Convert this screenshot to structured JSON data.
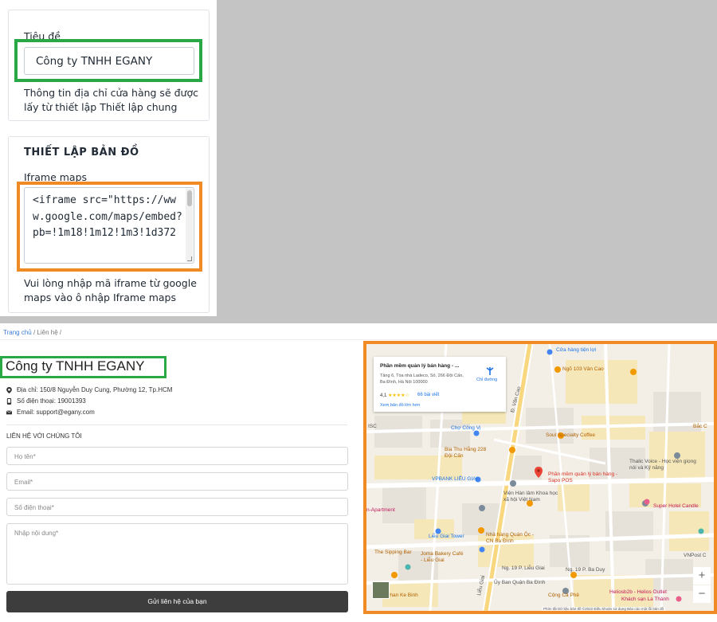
{
  "admin": {
    "title_card": {
      "label": "Tiêu đề",
      "value": "Công ty TNHH EGANY",
      "help": "Thông tin địa chỉ cửa hàng sẽ được lấy từ thiết lập Thiết lập chung"
    },
    "map_card": {
      "heading": "THIẾT LẬP BẢN ĐỒ",
      "label": "Iframe maps",
      "value": "<iframe src=\"https://www.google.com/maps/embed?pb=!1m18!1m12!1m3!1d372",
      "help": "Vui lòng nhập mã iframe từ google maps vào ô nhập Iframe maps"
    },
    "colors": {
      "highlight_green": "#2aa845",
      "highlight_orange": "#f08a24"
    }
  },
  "storefront": {
    "breadcrumb": {
      "home": "Trang chủ",
      "sep1": " / ",
      "current": "Liên hệ",
      "sep2": " /"
    },
    "company_name": "Công ty TNHH EGANY",
    "info": {
      "address": "Địa chỉ: 150/8 Nguyễn Duy Cung, Phường 12, Tp.HCM",
      "phone": "Số điện thoại: 19001393",
      "email": "Email: support@egany.com"
    },
    "contact_heading": "LIÊN HỆ VỚI CHÚNG TÔI",
    "form": {
      "name_placeholder": "Họ tên*",
      "email_placeholder": "Email*",
      "phone_placeholder": "Số điện thoại*",
      "message_placeholder": "Nhập nội dung*",
      "submit_label": "Gửi liên hệ của bạn"
    }
  },
  "map": {
    "place_title": "Phần mềm quản lý bán hàng - ...",
    "place_address": "Tầng 6, Tòa nhà Ladeco, Số, 266 Đội Cấn, Ba Đình, Hà Nội 100000",
    "rating": "4,1",
    "stars": "★★★★☆",
    "reviews": "66 bài viết",
    "larger_map": "Xem bản đồ lớn hơn",
    "directions": "Chỉ đường",
    "marker_label": "Phần mềm quản lý bán hàng - Sapo POS",
    "labels": {
      "ngo103": "Ngõ 103 Vân Cao",
      "soul": "Soul Specialty Coffee",
      "chocong": "Chợ Công Vị",
      "bia": "Bia Thu Hằng 228 Đội Cấn",
      "vpbank": "VPBANK LIỄU GIAI",
      "vien": "Viện Hàn lâm Khoa học xã hội Việt Nam",
      "thalic": "Thalic Voice - Học viện giọng nói và Kỹ năng",
      "superhotel": "Super Hotel Candle",
      "tower": "Liễu Giai Tower",
      "joma": "Joma Bakery Café - Liễu Giai",
      "nhahang": "Nhà hàng Quán Ộc - CN Ba Đình",
      "sipping": "The Sipping Bar",
      "apartment": "n-Apartment",
      "uyban": "Ủy Ban Quận Ba Đình",
      "congcaphe": "Cộng Cà Phê",
      "helios": "Heliosb2b - Helios Outlet",
      "khachsan": "Khách sạn La Thành",
      "phan": "Phan Ke Binh",
      "bac": "Bắc C",
      "vnpost": "VNPost C",
      "isc": "ISC",
      "vancao": "Đ. Văn Cao",
      "lieugiai": "Liễu Giai",
      "p_lieugiai": "Ng. 19 P. Liễu Giai",
      "babuy": "Ng. 19 P. Ba Duy",
      "nguyen": "Cửa hàng tiện lợi"
    },
    "footer": "Phím tắt   Dữ liệu bản đồ ©2022   Điều khoản sử dụng   Báo cáo một lỗi bản đồ"
  }
}
